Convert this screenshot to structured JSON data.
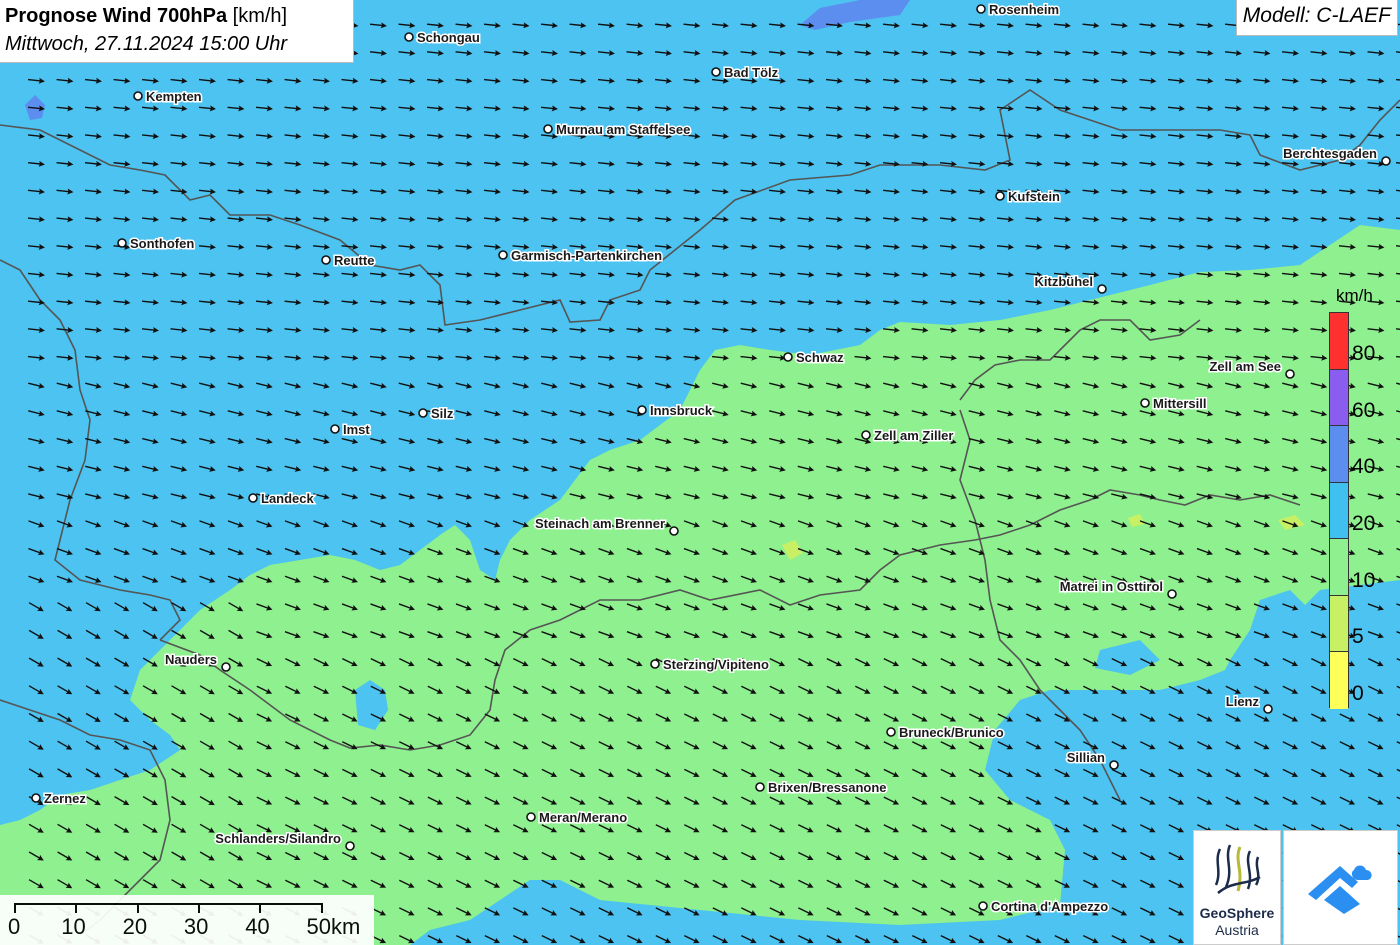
{
  "title": {
    "main": "Prognose Wind 700hPa",
    "unit": "[km/h]",
    "datetime": "Mittwoch, 27.11.2024 15:00 Uhr"
  },
  "model": "Modell: C-LAEF",
  "legend": {
    "unit": "km/h",
    "labels": [
      "80",
      "60",
      "40",
      "20",
      "10",
      "5",
      "0"
    ],
    "colors": [
      "#ff3030",
      "#8a5cf0",
      "#5c8ef0",
      "#3fc0f0",
      "#8ef08e",
      "#c8f064",
      "#ffff5a"
    ]
  },
  "scale": {
    "labels": [
      "0",
      "10",
      "20",
      "30",
      "40",
      "50km"
    ]
  },
  "logos": {
    "geosphere_name": "GeoSphere",
    "geosphere_sub": "Austria"
  },
  "cities": [
    {
      "name": "Rosenheim",
      "label_side": "right"
    },
    {
      "name": "Schongau",
      "label_side": "right"
    },
    {
      "name": "Bad Tölz",
      "label_side": "right"
    },
    {
      "name": "Kempten",
      "label_side": "right"
    },
    {
      "name": "Murnau am Staffelsee",
      "label_side": "right"
    },
    {
      "name": "Berchtesgaden",
      "label_side": "left"
    },
    {
      "name": "Kufstein",
      "label_side": "right"
    },
    {
      "name": "Sonthofen",
      "label_side": "right"
    },
    {
      "name": "Reutte",
      "label_side": "right"
    },
    {
      "name": "Garmisch-Partenkirchen",
      "label_side": "right"
    },
    {
      "name": "Kitzbühel",
      "label_side": "left"
    },
    {
      "name": "Schwaz",
      "label_side": "right"
    },
    {
      "name": "Zell am See",
      "label_side": "left"
    },
    {
      "name": "Mittersill",
      "label_side": "right"
    },
    {
      "name": "Silz",
      "label_side": "right"
    },
    {
      "name": "Innsbruck",
      "label_side": "right"
    },
    {
      "name": "Imst",
      "label_side": "right"
    },
    {
      "name": "Zell am Ziller",
      "label_side": "right"
    },
    {
      "name": "Landeck",
      "label_side": "right"
    },
    {
      "name": "Steinach am Brenner",
      "label_side": "left"
    },
    {
      "name": "Matrei in Osttirol",
      "label_side": "left"
    },
    {
      "name": "Nauders",
      "label_side": "left"
    },
    {
      "name": "Sterzing/Vipiteno",
      "label_side": "right"
    },
    {
      "name": "Lienz",
      "label_side": "left"
    },
    {
      "name": "Bruneck/Brunico",
      "label_side": "right"
    },
    {
      "name": "Sillian",
      "label_side": "left"
    },
    {
      "name": "Brixen/Bressanone",
      "label_side": "right"
    },
    {
      "name": "Zernez",
      "label_side": "right"
    },
    {
      "name": "Meran/Merano",
      "label_side": "right"
    },
    {
      "name": "Schlanders/Silandro",
      "label_side": "left"
    },
    {
      "name": "Cortina d'Ampezzo",
      "label_side": "right"
    }
  ],
  "colors": {
    "wind_10_20": "#8ef08e",
    "wind_20_40": "#4cc3f0",
    "wind_40_60": "#5c8ef0",
    "wind_5_10": "#c8f064",
    "border": "#555555",
    "arrow": "#111111"
  }
}
